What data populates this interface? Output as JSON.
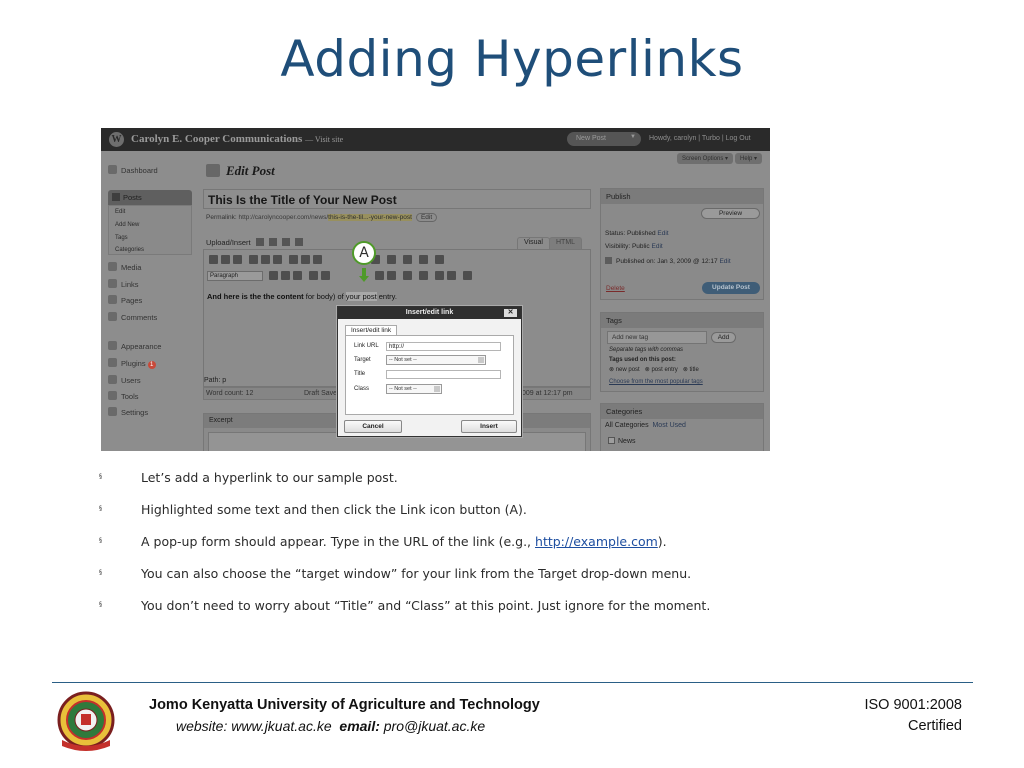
{
  "slide": {
    "title": "Adding Hyperlinks"
  },
  "wp": {
    "site_name": "Carolyn E. Cooper Communications",
    "visit_site": "— Visit site",
    "new_post": "New Post",
    "howdy": "Howdy, carolyn | Turbo | Log Out",
    "screen_options": "Screen Options ▾",
    "help": "Help ▾",
    "menu": {
      "dashboard": "Dashboard",
      "posts": "Posts",
      "posts_sub": [
        "Edit",
        "Add New",
        "Tags",
        "Categories"
      ],
      "media": "Media",
      "links": "Links",
      "pages": "Pages",
      "comments": "Comments",
      "appearance": "Appearance",
      "plugins": "Plugins",
      "plugins_count": "1",
      "users": "Users",
      "tools": "Tools",
      "settings": "Settings"
    },
    "edit_post_heading": "Edit Post",
    "post_title": "This Is the Title of Your New Post",
    "permalink_label": "Permalink:",
    "permalink_url": "http://carolyncooper.com/news/",
    "permalink_slug": "this-is-the-til...-your-new-post",
    "permalink_edit": "Edit",
    "upload_insert": "Upload/Insert",
    "tab_visual": "Visual",
    "tab_html": "HTML",
    "format_select": "Paragraph",
    "content_before": "And here is the the content",
    "content_mid": " for body) of ",
    "content_sel": "your post",
    "content_after": " entry.",
    "path": "Path: p",
    "word_count": "Word count: 12",
    "draft_saved": "Draft Saved",
    "saved_time": "009 at 12:17 pm",
    "excerpt": "Excerpt",
    "publish": {
      "heading": "Publish",
      "preview": "Preview",
      "status": "Status: Published",
      "status_edit": "Edit",
      "visibility": "Visibility: Public",
      "visibility_edit": "Edit",
      "published_on": "Published on: Jan 3, 2009 @ 12:17",
      "published_edit": "Edit",
      "delete": "Delete",
      "update": "Update Post"
    },
    "tags": {
      "heading": "Tags",
      "placeholder": "Add new tag",
      "add": "Add",
      "hint": "Separate tags with commas",
      "used_label": "Tags used on this post:",
      "used": [
        "new post",
        "post entry",
        "title"
      ],
      "popular": "Choose from the most popular tags"
    },
    "categories": {
      "heading": "Categories",
      "tab_all": "All Categories",
      "tab_most": "Most Used",
      "item": "News"
    }
  },
  "callout": {
    "label": "A"
  },
  "dialog": {
    "title": "Insert/edit link",
    "tab": "Insert/edit link",
    "link_url_label": "Link URL",
    "link_url_value": "http://",
    "target_label": "Target",
    "target_value": "-- Not set --",
    "title_label": "Title",
    "class_label": "Class",
    "class_value": "-- Not set --",
    "cancel": "Cancel",
    "insert": "Insert",
    "close": "✕"
  },
  "bullets": {
    "marker": "§",
    "b1": "Let’s add a hyperlink to our sample post.",
    "b2": "Highlighted some text and then click the Link icon button (A).",
    "b3_before": "A pop-up form should appear. Type in the URL of the link (e.g., ",
    "b3_link": "http://example.com",
    "b3_after": ").",
    "b4": "You can also choose the “target window” for your link from the Target drop-down menu.",
    "b5": "You don’t need to worry about “Title” and “Class” at this point. Just ignore for the moment."
  },
  "footer": {
    "institution": "Jomo Kenyatta University of Agriculture and Technology",
    "website_label": "website:",
    "website": "www.jkuat.ac.ke",
    "email_label": "email:",
    "email": "pro@jkuat.ac.ke",
    "iso": "ISO 9001:2008",
    "certified": "Certified"
  },
  "colors": {
    "title_blue": "#1f4e79",
    "callout_green": "#4f9a29",
    "rule": "#2a5f86"
  }
}
